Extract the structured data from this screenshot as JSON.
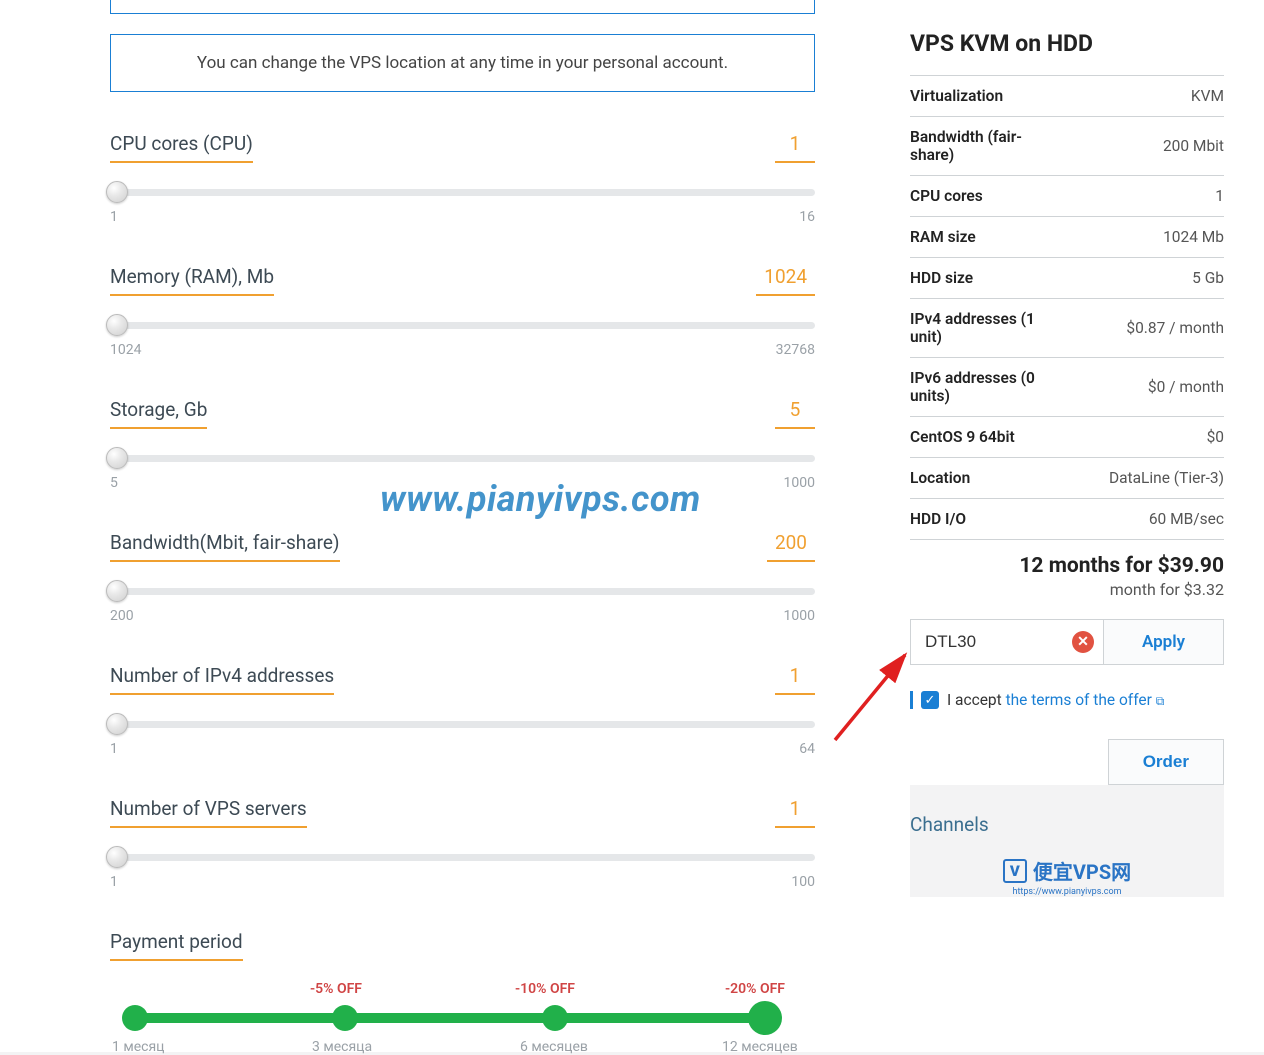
{
  "info_note": "You can change the VPS location at any time in your personal account.",
  "sliders": {
    "cpu": {
      "label": "CPU cores (CPU)",
      "value": "1",
      "min": "1",
      "max": "16"
    },
    "ram": {
      "label": "Memory (RAM), Mb",
      "value": "1024",
      "min": "1024",
      "max": "32768"
    },
    "disk": {
      "label": "Storage, Gb",
      "value": "5",
      "min": "5",
      "max": "1000"
    },
    "bw": {
      "label": "Bandwidth(Mbit, fair-share)",
      "value": "200",
      "min": "200",
      "max": "1000"
    },
    "ipv4": {
      "label": "Number of IPv4 addresses",
      "value": "1",
      "min": "1",
      "max": "64"
    },
    "srv": {
      "label": "Number of VPS servers",
      "value": "1",
      "min": "1",
      "max": "100"
    }
  },
  "payment": {
    "label": "Payment period",
    "nodes": [
      {
        "off": "",
        "label": "1 месяц"
      },
      {
        "off": "-5% OFF",
        "label": "3 месяца"
      },
      {
        "off": "-10% OFF",
        "label": "6 месяцев"
      },
      {
        "off": "-20% OFF",
        "label": "12 месяцев"
      }
    ]
  },
  "watermark": "www.pianyivps.com",
  "summary": {
    "title": "VPS KVM on HDD",
    "rows": [
      {
        "k": "Virtualization",
        "v": "KVM"
      },
      {
        "k": "Bandwidth (fair-share)",
        "v": "200 Mbit"
      },
      {
        "k": "CPU cores",
        "v": "1"
      },
      {
        "k": "RAM size",
        "v": "1024 Mb"
      },
      {
        "k": "HDD size",
        "v": "5 Gb"
      },
      {
        "k": "IPv4 addresses (1 unit)",
        "v": "$0.87 / month"
      },
      {
        "k": "IPv6 addresses (0 units)",
        "v": "$0 / month"
      },
      {
        "k": "CentOS 9 64bit",
        "v": "$0"
      },
      {
        "k": "Location",
        "v": "DataLine (Tier-3)"
      },
      {
        "k": "HDD I/O",
        "v": "60 MB/sec"
      }
    ],
    "total": "12 months for $39.90",
    "subtotal": "month for $3.32"
  },
  "promo": {
    "code": "DTL30",
    "apply": "Apply"
  },
  "accept": {
    "text": "I accept ",
    "link": "the terms of the offer"
  },
  "order_btn": "Order",
  "channels": {
    "title": "Channels",
    "logo_text": "便宜VPS网",
    "logo_sub": "https://www.pianyivps.com"
  }
}
